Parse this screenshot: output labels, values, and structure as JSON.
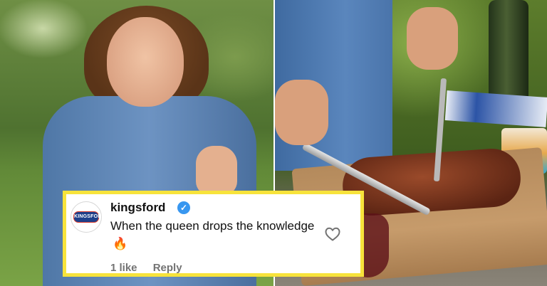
{
  "comment": {
    "username": "kingsford",
    "verified_badge": "✓",
    "text": "When the queen drops the knowledge",
    "emoji": "🔥",
    "likes": "1 like",
    "reply_label": "Reply",
    "avatar_logo_text": "KINGSFORD",
    "border_color": "#f7e33b"
  },
  "icons": {
    "verified": "verified-check-icon",
    "heart": "heart-outline-icon",
    "fire": "fire-emoji-icon"
  }
}
